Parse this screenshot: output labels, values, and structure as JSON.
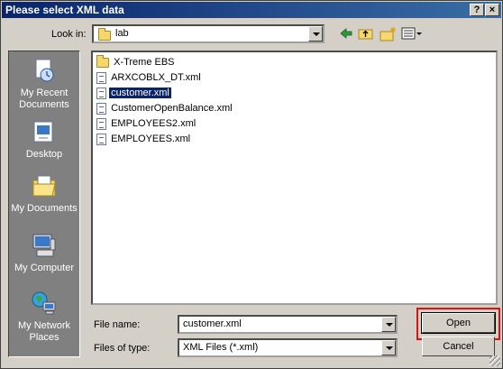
{
  "window": {
    "title": "Please select XML data",
    "help_label": "?",
    "close_label": "×"
  },
  "toolbar": {
    "look_in_label": "Look in:",
    "look_in_value": "lab",
    "icons": [
      "back-arrow-icon",
      "up-folder-icon",
      "new-folder-icon",
      "view-menu-icon"
    ]
  },
  "places": [
    {
      "name": "recent",
      "label": "My Recent Documents",
      "icon": "recent-documents-icon"
    },
    {
      "name": "desktop",
      "label": "Desktop",
      "icon": "desktop-icon"
    },
    {
      "name": "documents",
      "label": "My Documents",
      "icon": "my-documents-icon"
    },
    {
      "name": "computer",
      "label": "My Computer",
      "icon": "my-computer-icon"
    },
    {
      "name": "network",
      "label": "My Network Places",
      "icon": "network-places-icon"
    }
  ],
  "files": [
    {
      "name": "X-Treme EBS",
      "type": "folder",
      "selected": false
    },
    {
      "name": "ARXCOBLX_DT.xml",
      "type": "file",
      "selected": false
    },
    {
      "name": "customer.xml",
      "type": "file",
      "selected": true
    },
    {
      "name": "CustomerOpenBalance.xml",
      "type": "file",
      "selected": false
    },
    {
      "name": "EMPLOYEES2.xml",
      "type": "file",
      "selected": false
    },
    {
      "name": "EMPLOYEES.xml",
      "type": "file",
      "selected": false
    }
  ],
  "form": {
    "file_name_label": "File name:",
    "file_name_value": "customer.xml",
    "file_type_label": "Files of type:",
    "file_type_value": "XML Files (*.xml)"
  },
  "buttons": {
    "open_label": "Open",
    "cancel_label": "Cancel"
  },
  "colors": {
    "title_bar": "#0a246a",
    "selection": "#0a246a",
    "highlight_box": "#e01010",
    "places_bar": "#808080"
  }
}
